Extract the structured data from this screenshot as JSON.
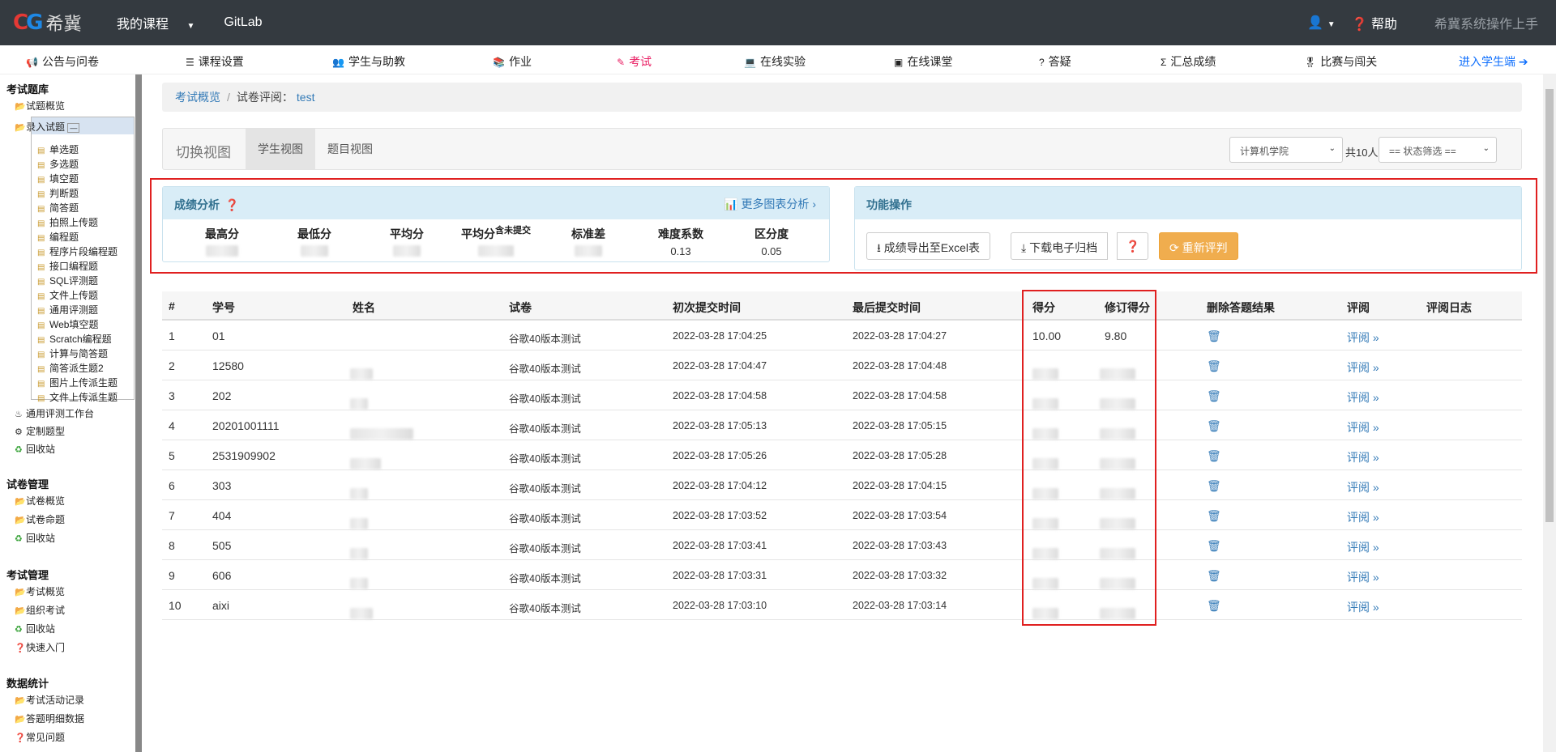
{
  "topbar": {
    "logo_text": "希冀",
    "menu_my_courses": "我的课程",
    "menu_gitlab": "GitLab",
    "help": "帮助",
    "guide": "希冀系统操作上手"
  },
  "subnav": {
    "items": [
      "公告与问卷",
      "课程设置",
      "学生与助教",
      "作业",
      "考试",
      "在线实验",
      "在线课堂",
      "答疑",
      "汇总成绩",
      "比赛与闯关"
    ],
    "student_entry": "进入学生端"
  },
  "sidebar": {
    "section_bank": "考试题库",
    "bank_overview": "试题概览",
    "enter_questions": "录入试题",
    "question_types": [
      "单选题",
      "多选题",
      "填空题",
      "判断题",
      "简答题",
      "拍照上传题",
      "编程题",
      "程序片段编程题",
      "接口编程题",
      "SQL评测题",
      "文件上传题",
      "通用评测题",
      "Web填空题",
      "Scratch编程题",
      "计算与简答题",
      "简答派生题2",
      "图片上传派生题",
      "文件上传派生题"
    ],
    "workbench": "通用评测工作台",
    "custom_types": "定制题型",
    "recycle": "回收站",
    "section_papers": "试卷管理",
    "paper_overview": "试卷概览",
    "paper_compose": "试卷命题",
    "section_exams": "考试管理",
    "exam_overview": "考试概览",
    "organize_exam": "组织考试",
    "quick_start": "快速入门",
    "section_stats": "数据统计",
    "activity_log": "考试活动记录",
    "answer_details": "答题明细数据",
    "faq": "常见问题"
  },
  "breadcrumb": {
    "root": "考试概览",
    "current": "试卷评阅：",
    "paper": "test"
  },
  "view": {
    "label": "切换视图",
    "tab_student": "学生视图",
    "tab_question": "题目视图",
    "college_select": "计算机学院",
    "count_text": "共10人",
    "status_select": "== 状态筛选 =="
  },
  "analysis": {
    "title": "成绩分析",
    "more_link": "更多图表分析",
    "stats": [
      {
        "label": "最高分",
        "value": ""
      },
      {
        "label": "最低分",
        "value": ""
      },
      {
        "label": "平均分",
        "value": ""
      },
      {
        "label": "平均分",
        "suffix": "含未提交",
        "value": ""
      },
      {
        "label": "标准差",
        "value": ""
      },
      {
        "label": "难度系数",
        "value": "0.13"
      },
      {
        "label": "区分度",
        "value": "0.05"
      }
    ]
  },
  "operations": {
    "title": "功能操作",
    "export_excel": "成绩导出至Excel表",
    "download_archive": "下载电子归档",
    "rejudge": "重新评判"
  },
  "table": {
    "headers": [
      "#",
      "学号",
      "姓名",
      "试卷",
      "初次提交时间",
      "最后提交时间",
      "得分",
      "修订得分",
      "删除答题结果",
      "评阅",
      "评阅日志"
    ],
    "review_link": "评阅 »",
    "rows": [
      {
        "no": "1",
        "id": "01",
        "paper": "谷歌40版本测试",
        "first": "2022-03-28 17:04:25",
        "last": "2022-03-28 17:04:27",
        "score": "10.00",
        "revised": "9.80"
      },
      {
        "no": "2",
        "id": "12580",
        "paper": "谷歌40版本测试",
        "first": "2022-03-28 17:04:47",
        "last": "2022-03-28 17:04:48",
        "score": "",
        "revised": ""
      },
      {
        "no": "3",
        "id": "202",
        "paper": "谷歌40版本测试",
        "first": "2022-03-28 17:04:58",
        "last": "2022-03-28 17:04:58",
        "score": "",
        "revised": ""
      },
      {
        "no": "4",
        "id": "20201001111",
        "paper": "谷歌40版本测试",
        "first": "2022-03-28 17:05:13",
        "last": "2022-03-28 17:05:15",
        "score": "",
        "revised": ""
      },
      {
        "no": "5",
        "id": "2531909902",
        "paper": "谷歌40版本测试",
        "first": "2022-03-28 17:05:26",
        "last": "2022-03-28 17:05:28",
        "score": "",
        "revised": ""
      },
      {
        "no": "6",
        "id": "303",
        "paper": "谷歌40版本测试",
        "first": "2022-03-28 17:04:12",
        "last": "2022-03-28 17:04:15",
        "score": "",
        "revised": ""
      },
      {
        "no": "7",
        "id": "404",
        "paper": "谷歌40版本测试",
        "first": "2022-03-28 17:03:52",
        "last": "2022-03-28 17:03:54",
        "score": "",
        "revised": ""
      },
      {
        "no": "8",
        "id": "505",
        "paper": "谷歌40版本测试",
        "first": "2022-03-28 17:03:41",
        "last": "2022-03-28 17:03:43",
        "score": "",
        "revised": ""
      },
      {
        "no": "9",
        "id": "606",
        "paper": "谷歌40版本测试",
        "first": "2022-03-28 17:03:31",
        "last": "2022-03-28 17:03:32",
        "score": "",
        "revised": ""
      },
      {
        "no": "10",
        "id": "aixi",
        "paper": "谷歌40版本测试",
        "first": "2022-03-28 17:03:10",
        "last": "2022-03-28 17:03:14",
        "score": "",
        "revised": ""
      }
    ]
  }
}
